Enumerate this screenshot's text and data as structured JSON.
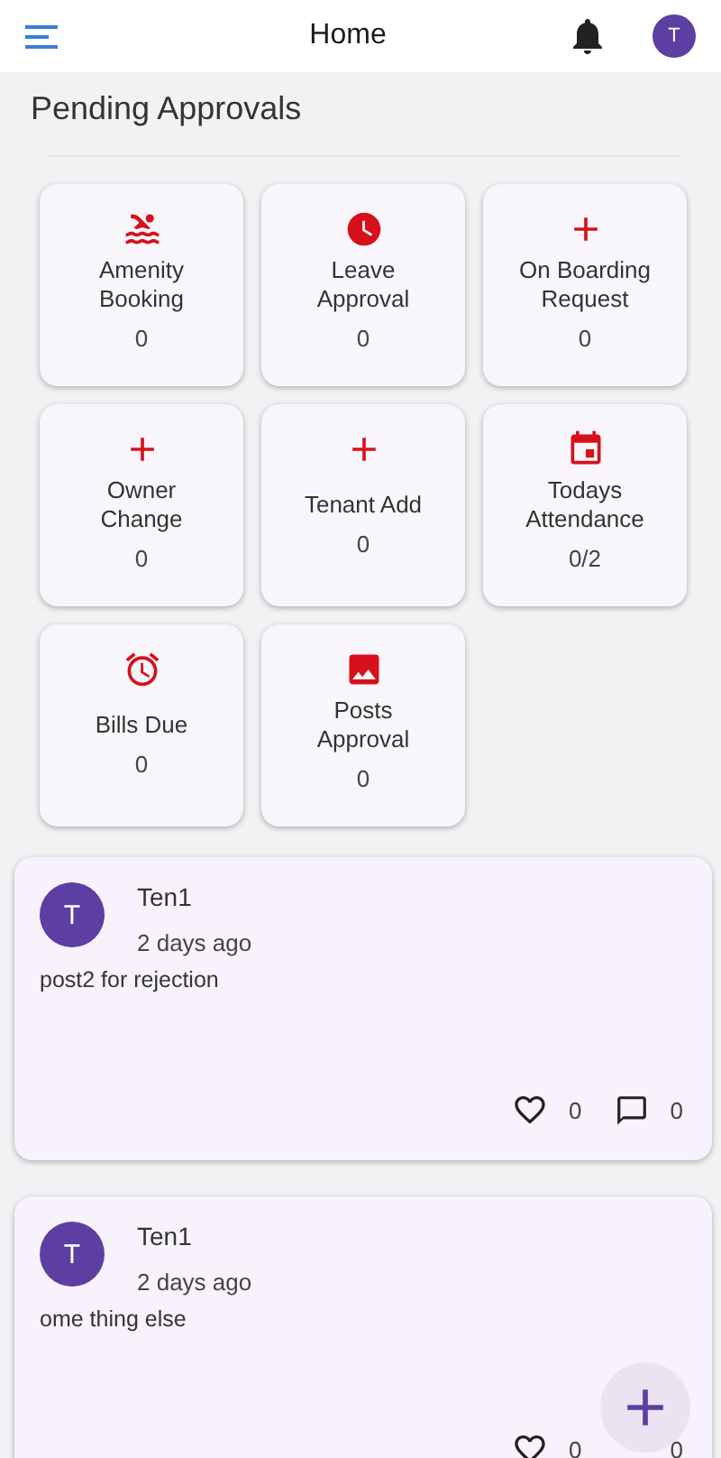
{
  "app_bar": {
    "title": "Home",
    "avatar_initial": "T"
  },
  "section_title": "Pending Approvals",
  "tiles": [
    {
      "kind": "pool",
      "label": "Amenity Booking",
      "count": "0"
    },
    {
      "kind": "clock",
      "label": "Leave Approval",
      "count": "0"
    },
    {
      "kind": "add",
      "label": "On Boarding Request",
      "count": "0"
    },
    {
      "kind": "add",
      "label": "Owner Change",
      "count": "0"
    },
    {
      "kind": "add",
      "label": "Tenant Add",
      "count": "0"
    },
    {
      "kind": "calendar",
      "label": "Todays Attendance",
      "count": "0/2"
    },
    {
      "kind": "alarm",
      "label": "Bills Due",
      "count": "0"
    },
    {
      "kind": "image",
      "label": "Posts Approval",
      "count": "0"
    }
  ],
  "posts": [
    {
      "avatar_initial": "T",
      "author": "Ten1",
      "time": "2 days ago",
      "text": "post2 for rejection",
      "likes": "0",
      "comment_icon_visible": true,
      "comments": "0"
    },
    {
      "avatar_initial": "T",
      "author": "Ten1",
      "time": "2 days ago",
      "text": "ome thing else",
      "likes": "0",
      "comment_icon_visible": false,
      "comments": "0"
    }
  ]
}
